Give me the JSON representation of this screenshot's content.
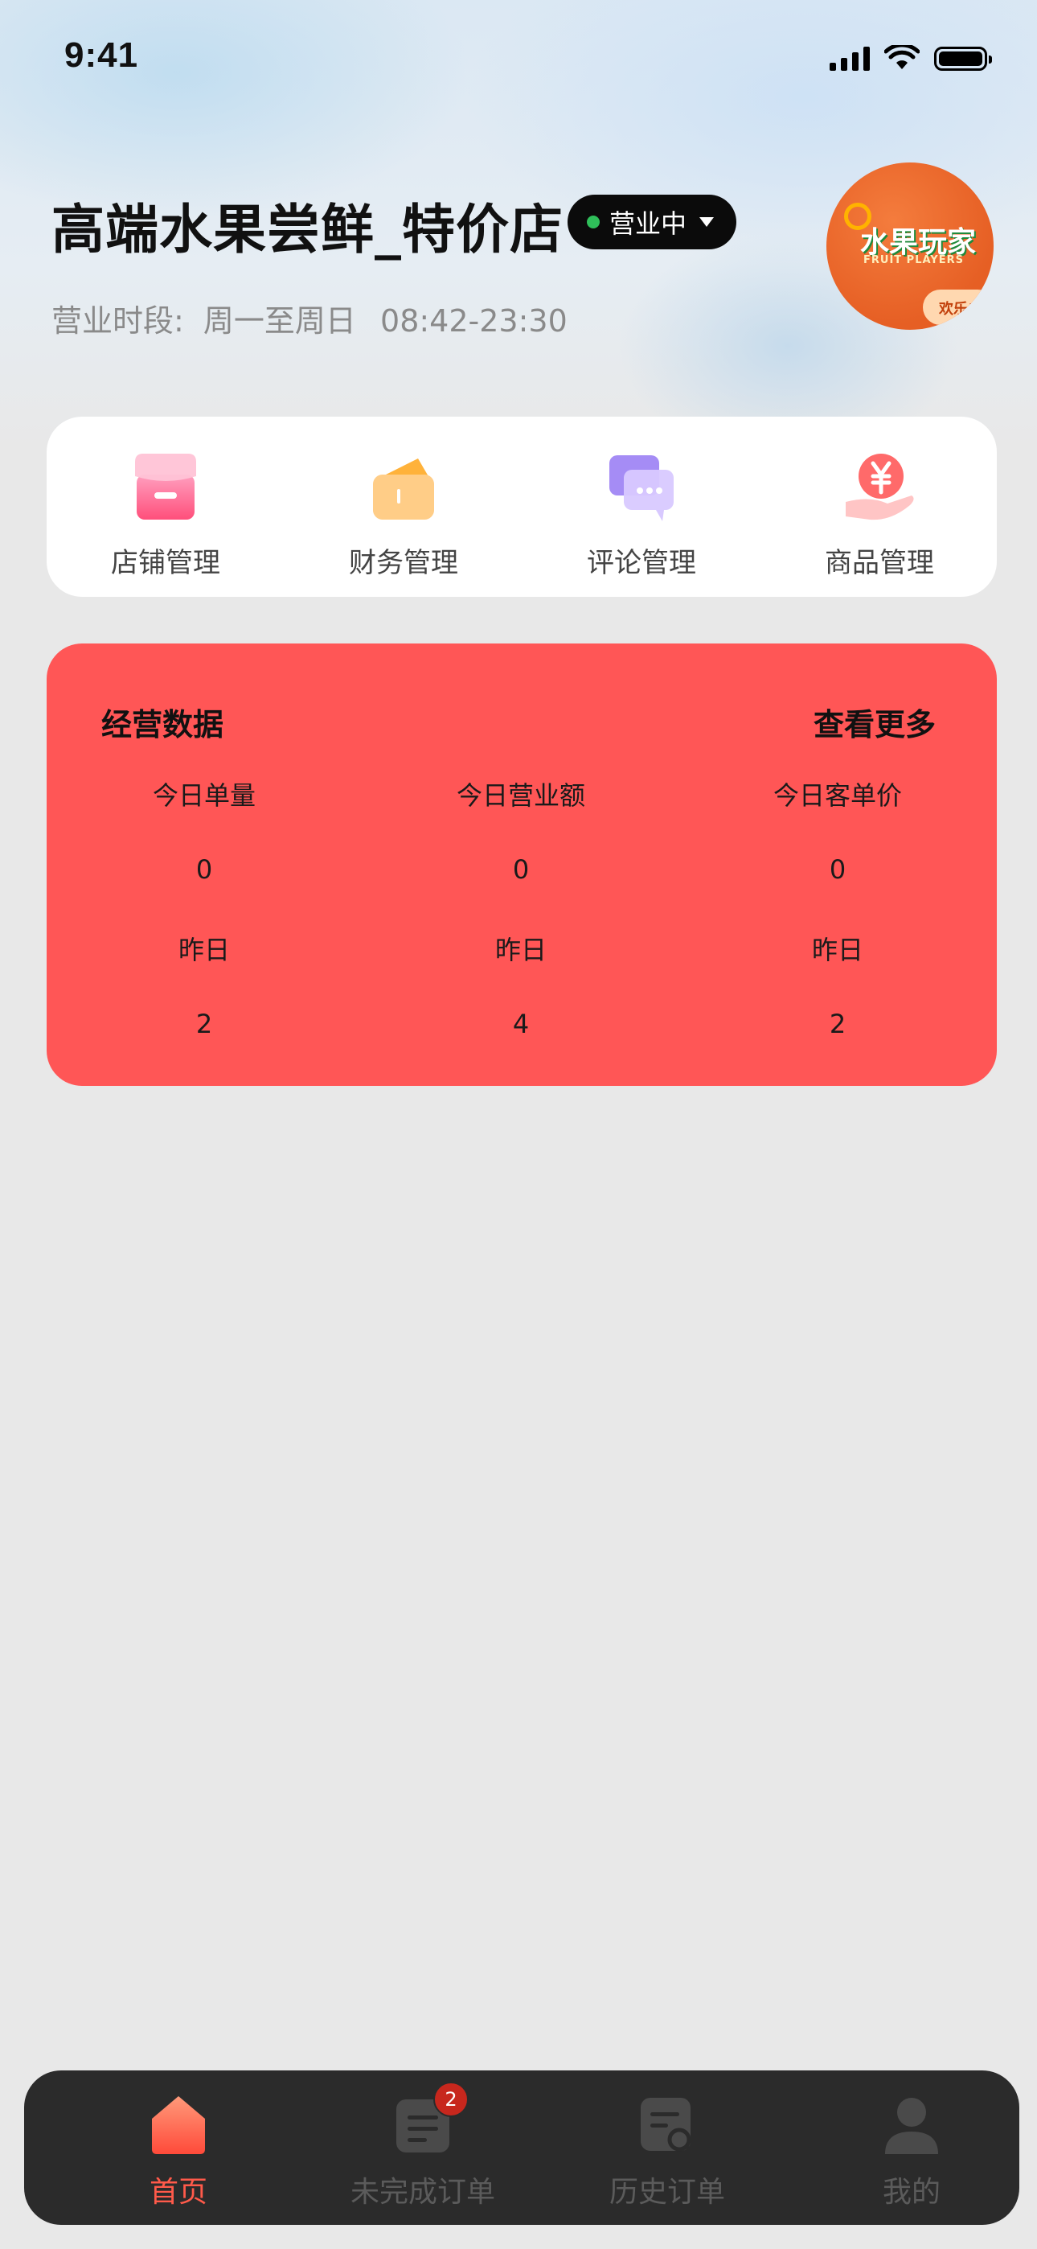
{
  "status_bar": {
    "time": "9:41"
  },
  "header": {
    "store_name": "高端水果尝鲜_特价店",
    "status_label": "营业中",
    "hours_label": "营业时段:",
    "hours_days": "周一至周日",
    "hours_time": "08:42-23:30",
    "logo": {
      "text_cn": "水果玩家",
      "text_en": "FRUIT PLAYERS",
      "tag": "欢乐!"
    }
  },
  "quick_actions": [
    {
      "label": "店铺管理",
      "icon": "store-icon"
    },
    {
      "label": "财务管理",
      "icon": "wallet-icon"
    },
    {
      "label": "评论管理",
      "icon": "comments-icon"
    },
    {
      "label": "商品管理",
      "icon": "yuan-hand-icon"
    }
  ],
  "stats": {
    "title": "经营数据",
    "more_label": "查看更多",
    "columns": [
      {
        "label": "今日单量",
        "today": "0",
        "yesterday_label": "昨日",
        "yesterday": "2"
      },
      {
        "label": "今日营业额",
        "today": "0",
        "yesterday_label": "昨日",
        "yesterday": "4"
      },
      {
        "label": "今日客单价",
        "today": "0",
        "yesterday_label": "昨日",
        "yesterday": "2"
      }
    ]
  },
  "tabbar": {
    "tabs": [
      {
        "label": "首页",
        "icon": "home-icon",
        "active": true
      },
      {
        "label": "未完成订单",
        "icon": "order-list-icon",
        "badge": "2"
      },
      {
        "label": "历史订单",
        "icon": "order-search-icon"
      },
      {
        "label": "我的",
        "icon": "user-icon"
      }
    ]
  },
  "colors": {
    "accent": "#ff5656",
    "tab_active": "#ff5a4a",
    "status_dot": "#2fbf5a"
  }
}
